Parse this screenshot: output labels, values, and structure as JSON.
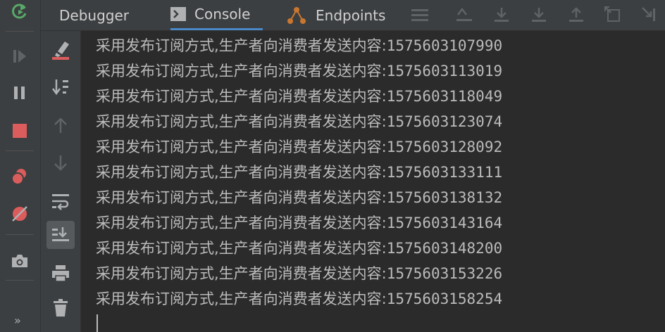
{
  "tabs": [
    {
      "label": "Debugger",
      "icon": "none"
    },
    {
      "label": "Console",
      "icon": "console-icon"
    },
    {
      "label": "Endpoints",
      "icon": "endpoints-icon"
    }
  ],
  "left_toolbar": {
    "more_label": "»",
    "icons": [
      "rerun-icon",
      "resume-icon",
      "pause-icon",
      "stop-icon",
      "view-breakpoints-icon",
      "mute-breakpoints-icon",
      "camera-icon"
    ]
  },
  "console_toolbar": {
    "icons": [
      "clear-console-icon",
      "sort-icon",
      "up-arrow-icon",
      "down-arrow-icon",
      "soft-wrap-icon",
      "scroll-to-end-icon",
      "print-icon",
      "trash-icon"
    ]
  },
  "colors": {
    "accent": "#4a88c7",
    "stop": "#db5c5c",
    "green": "#59a869",
    "bg": "#2b2b2b",
    "panel": "#3c3f41"
  },
  "console": {
    "prefix": "采用发布订阅方式,生产者向消费者发送内容:",
    "lines": [
      "1575603107990",
      "1575603113019",
      "1575603118049",
      "1575603123074",
      "1575603128092",
      "1575603133111",
      "1575603138132",
      "1575603143164",
      "1575603148200",
      "1575603153226",
      "1575603158254"
    ]
  }
}
